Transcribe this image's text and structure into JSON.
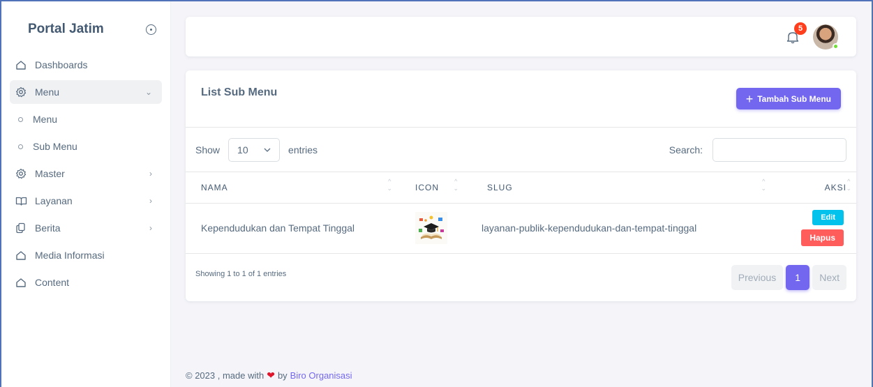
{
  "sidebar": {
    "brand": "Portal Jatim",
    "items": [
      {
        "label": "Dashboards",
        "icon": "home-icon"
      },
      {
        "label": "Menu",
        "icon": "gear-icon",
        "chevron": "⌄"
      },
      {
        "label": "Master",
        "icon": "gear-icon",
        "chevron": "›"
      },
      {
        "label": "Layanan",
        "icon": "book-icon",
        "chevron": "›"
      },
      {
        "label": "Berita",
        "icon": "copy-icon",
        "chevron": "›"
      },
      {
        "label": "Media Informasi",
        "icon": "home-icon"
      },
      {
        "label": "Content",
        "icon": "home-icon"
      }
    ],
    "submenu": [
      {
        "label": "Menu"
      },
      {
        "label": "Sub Menu"
      }
    ]
  },
  "navbar": {
    "notification_count": "5"
  },
  "card": {
    "title": "List Sub Menu",
    "add_button": "Tambah Sub Menu"
  },
  "controls": {
    "show_label": "Show",
    "page_size": "10",
    "entries_label": "entries",
    "search_label": "Search:",
    "search_value": ""
  },
  "table": {
    "headers": {
      "nama": "NAMA",
      "icon": "ICON",
      "slug": "SLUG",
      "aksi": "AKSI"
    },
    "rows": [
      {
        "nama": "Kependudukan dan Tempat Tinggal",
        "slug": "layanan-publik-kependudukan-dan-tempat-tinggal",
        "edit": "Edit",
        "hapus": "Hapus"
      }
    ]
  },
  "pagination": {
    "info": "Showing 1 to 1 of 1 entries",
    "previous": "Previous",
    "current": "1",
    "next": "Next"
  },
  "footer": {
    "prefix": "© 2023 , made with",
    "by": "by",
    "link": "Biro Organisasi"
  },
  "colors": {
    "primary": "#7367f0",
    "info": "#03c3ec",
    "danger": "#ff5c5c",
    "badge": "#ff3e1d"
  }
}
